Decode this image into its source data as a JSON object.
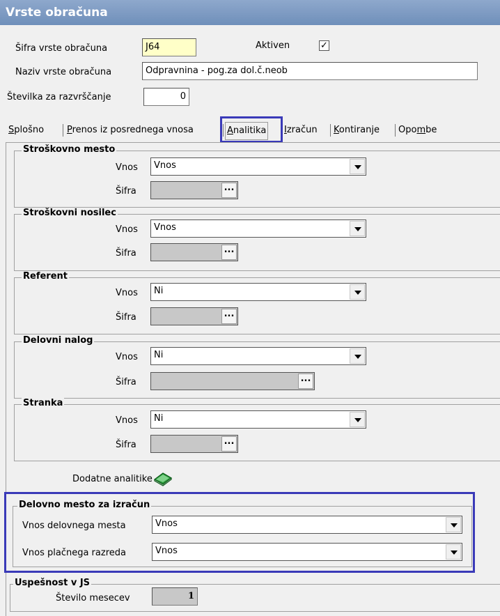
{
  "window": {
    "title": "Vrste obračuna"
  },
  "header": {
    "sifra_label": "Šifra vrste obračuna",
    "sifra_value": "J64",
    "aktiven_label": "Aktiven",
    "aktiven_checked": "✓",
    "naziv_label": "Naziv vrste obračuna",
    "naziv_value": "Odpravnina - pog.za dol.č.neob",
    "stevilka_label": "Številka za razvrščanje",
    "stevilka_value": "0"
  },
  "tabs": [
    {
      "label": "Splošno",
      "underline": "S",
      "rest": "plošno"
    },
    {
      "label": "Prenos iz posrednega vnosa",
      "underline": "P",
      "rest": "renos iz posrednega vnosa"
    },
    {
      "label": "Analitika",
      "underline": "A",
      "rest": "nalitika"
    },
    {
      "label": "Izračun",
      "underline": "I",
      "rest": "zračun"
    },
    {
      "label": "Kontiranje",
      "underline": "K",
      "rest": "ontiranje"
    },
    {
      "label": "Opombe",
      "pre": "Opo",
      "underline": "m",
      "rest": "be"
    }
  ],
  "groups": [
    {
      "title": "Stroškovno mesto",
      "vnos_label": "Vnos",
      "vnos_value": "Vnos",
      "sifra_label": "Šifra"
    },
    {
      "title": "Stroškovni nosilec",
      "vnos_label": "Vnos",
      "vnos_value": "Vnos",
      "sifra_label": "Šifra"
    },
    {
      "title": "Referent",
      "vnos_label": "Vnos",
      "vnos_value": "Ni",
      "sifra_label": "Šifra"
    },
    {
      "title": "Delovni nalog",
      "vnos_label": "Vnos",
      "vnos_value": "Ni",
      "sifra_label": "Šifra"
    },
    {
      "title": "Stranka",
      "vnos_label": "Vnos",
      "vnos_value": "Ni",
      "sifra_label": "Šifra"
    }
  ],
  "dodatne": {
    "label": "Dodatne analitike",
    "icon": "book-icon"
  },
  "delovno_mesto": {
    "title": "Delovno mesto za izračun",
    "vnos_dm_label": "Vnos delovnega mesta",
    "vnos_dm_value": "Vnos",
    "vnos_pr_label": "Vnos plačnega razreda",
    "vnos_pr_value": "Vnos"
  },
  "uspesnost": {
    "title": "Uspešnost v JS",
    "stevilo_label": "Število mesecev",
    "stevilo_value": "1"
  },
  "colors": {
    "highlight": "#3a3ab8",
    "title_bar": "#7a97c2",
    "icon_green": "#2a9a3a"
  }
}
